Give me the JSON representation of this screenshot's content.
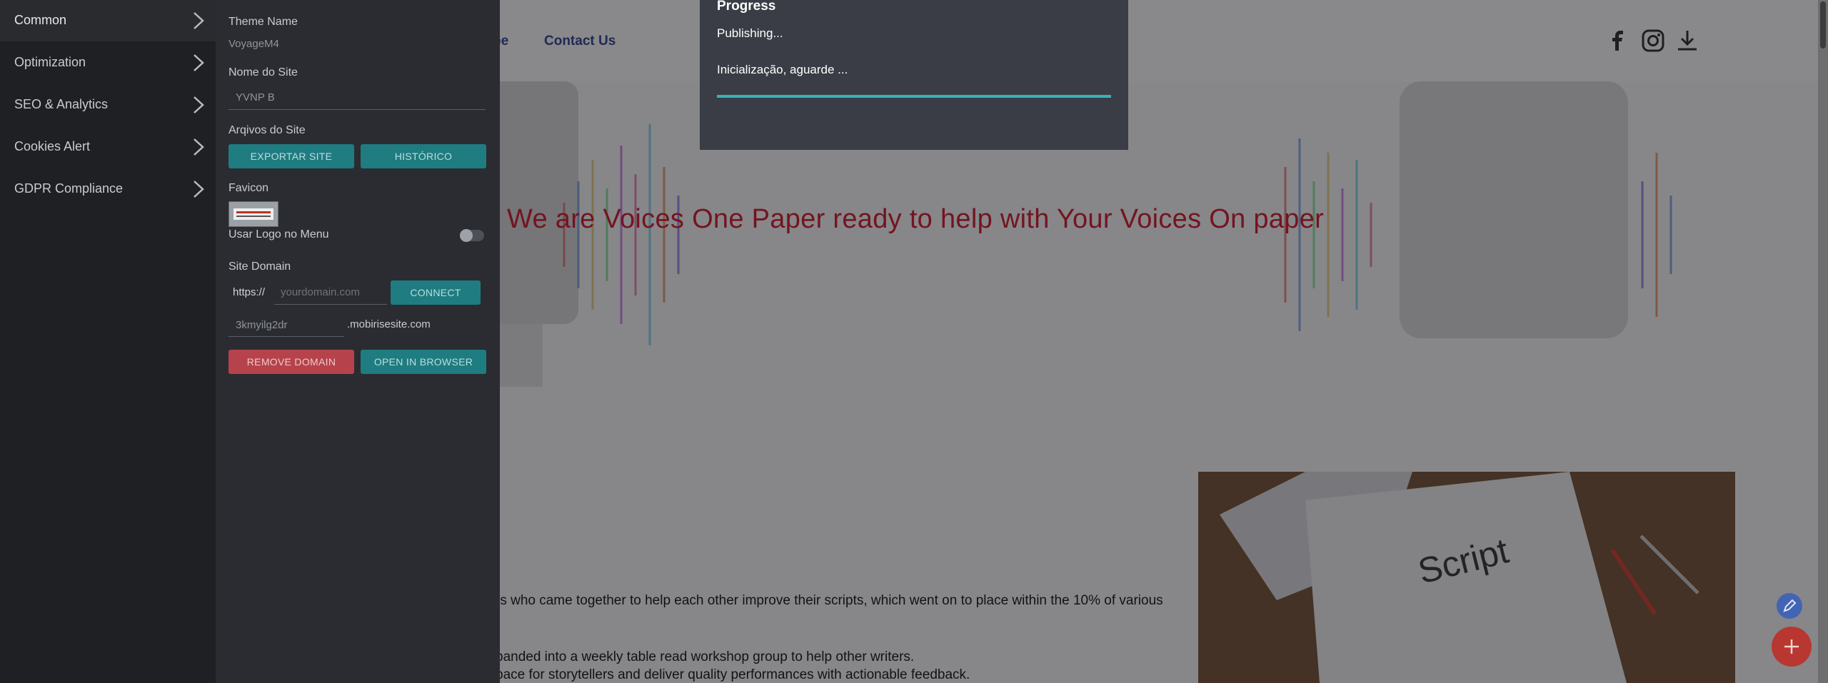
{
  "left_menu": {
    "items": [
      {
        "label": "Common"
      },
      {
        "label": "Optimization"
      },
      {
        "label": "SEO & Analytics"
      },
      {
        "label": "Cookies Alert"
      },
      {
        "label": "GDPR Compliance"
      }
    ]
  },
  "settings": {
    "theme_name_label": "Theme Name",
    "theme_name_value": "VoyageM4",
    "site_name_label": "Nome do Site",
    "site_name_value": "YVNP B",
    "site_files_label": "Arqivos do Site",
    "export_button": "EXPORTAR SITE",
    "history_button": "HISTÓRICO",
    "favicon_label": "Favicon",
    "use_logo_label": "Usar Logo no Menu",
    "use_logo_enabled": false,
    "site_domain_label": "Site Domain",
    "domain_prefix": "https://",
    "domain_placeholder": "yourdomain.com",
    "connect_button": "CONNECT",
    "subdomain_value": "3kmyilg2dr",
    "subdomain_suffix": ".mobirisesite.com",
    "remove_domain_button": "REMOVE DOMAIN",
    "open_browser_button": "OPEN IN BROWSER"
  },
  "progress": {
    "title": "Progress",
    "status": "Publishing...",
    "message": "Inicialização, aguarde ...",
    "fraction": 1.0
  },
  "site": {
    "nav": {
      "item_partial": "pe",
      "contact": "Contact Us"
    },
    "hero_title": "We are Voices One Paper ready to help with Your Voices On paper",
    "paragraph_1": "rs who came together to help each other improve their scripts, which went on to place within the 10% of various",
    "paragraph_2": "panded into a weekly table read workshop group to help other writers.",
    "paragraph_3": "pace for storytellers and deliver quality performances with actionable feedback.",
    "image_text": "Script"
  },
  "colors": {
    "accent_teal": "#1f7c80",
    "danger_red": "#b6434b",
    "progress_cyan": "#37b1bd",
    "hero_title_red": "#d5142b"
  },
  "icons": [
    "chevron-right-icon",
    "facebook-icon",
    "instagram-icon",
    "download-icon",
    "pencil-icon",
    "plus-icon"
  ]
}
